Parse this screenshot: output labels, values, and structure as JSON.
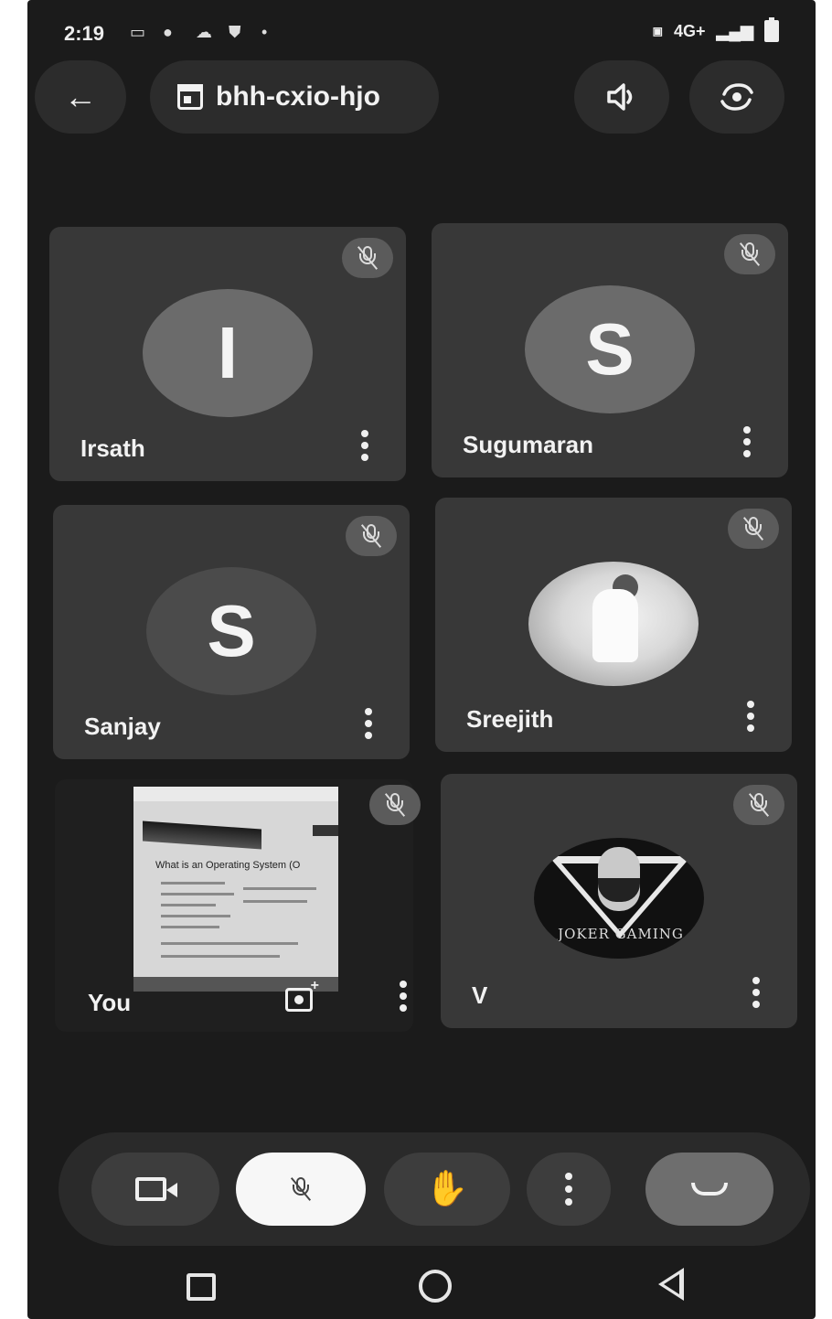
{
  "status_bar": {
    "time": "2:19",
    "network": "4G+"
  },
  "top_bar": {
    "meeting_code": "bhh-cxio-hjo",
    "back_icon": "arrow-left-icon",
    "speaker_icon": "volume-icon",
    "flip_icon": "camera-flip-icon"
  },
  "participants": [
    {
      "name": "Irsath",
      "initial": "I",
      "muted": true
    },
    {
      "name": "Sugumaran",
      "initial": "S",
      "muted": true
    },
    {
      "name": "Sanjay",
      "initial": "S",
      "muted": true
    },
    {
      "name": "Sreejith",
      "avatar": "photo",
      "muted": true
    },
    {
      "name": "You",
      "avatar": "camera-feed",
      "muted": true
    },
    {
      "name": "V",
      "avatar": "logo",
      "muted": true
    }
  ],
  "self_view": {
    "doc_heading": "What is an Operating System (O"
  },
  "v_logo_text": "JOKER GAMING",
  "controls": {
    "camera_icon": "video-camera-icon",
    "mic_icon": "mic-off-icon",
    "hand_icon": "raise-hand-icon",
    "more_icon": "more-vert-icon",
    "end_icon": "call-end-icon"
  },
  "colors": {
    "background": "#1b1b1b",
    "tile": "#383838",
    "end_call": "#6e6e6e"
  }
}
